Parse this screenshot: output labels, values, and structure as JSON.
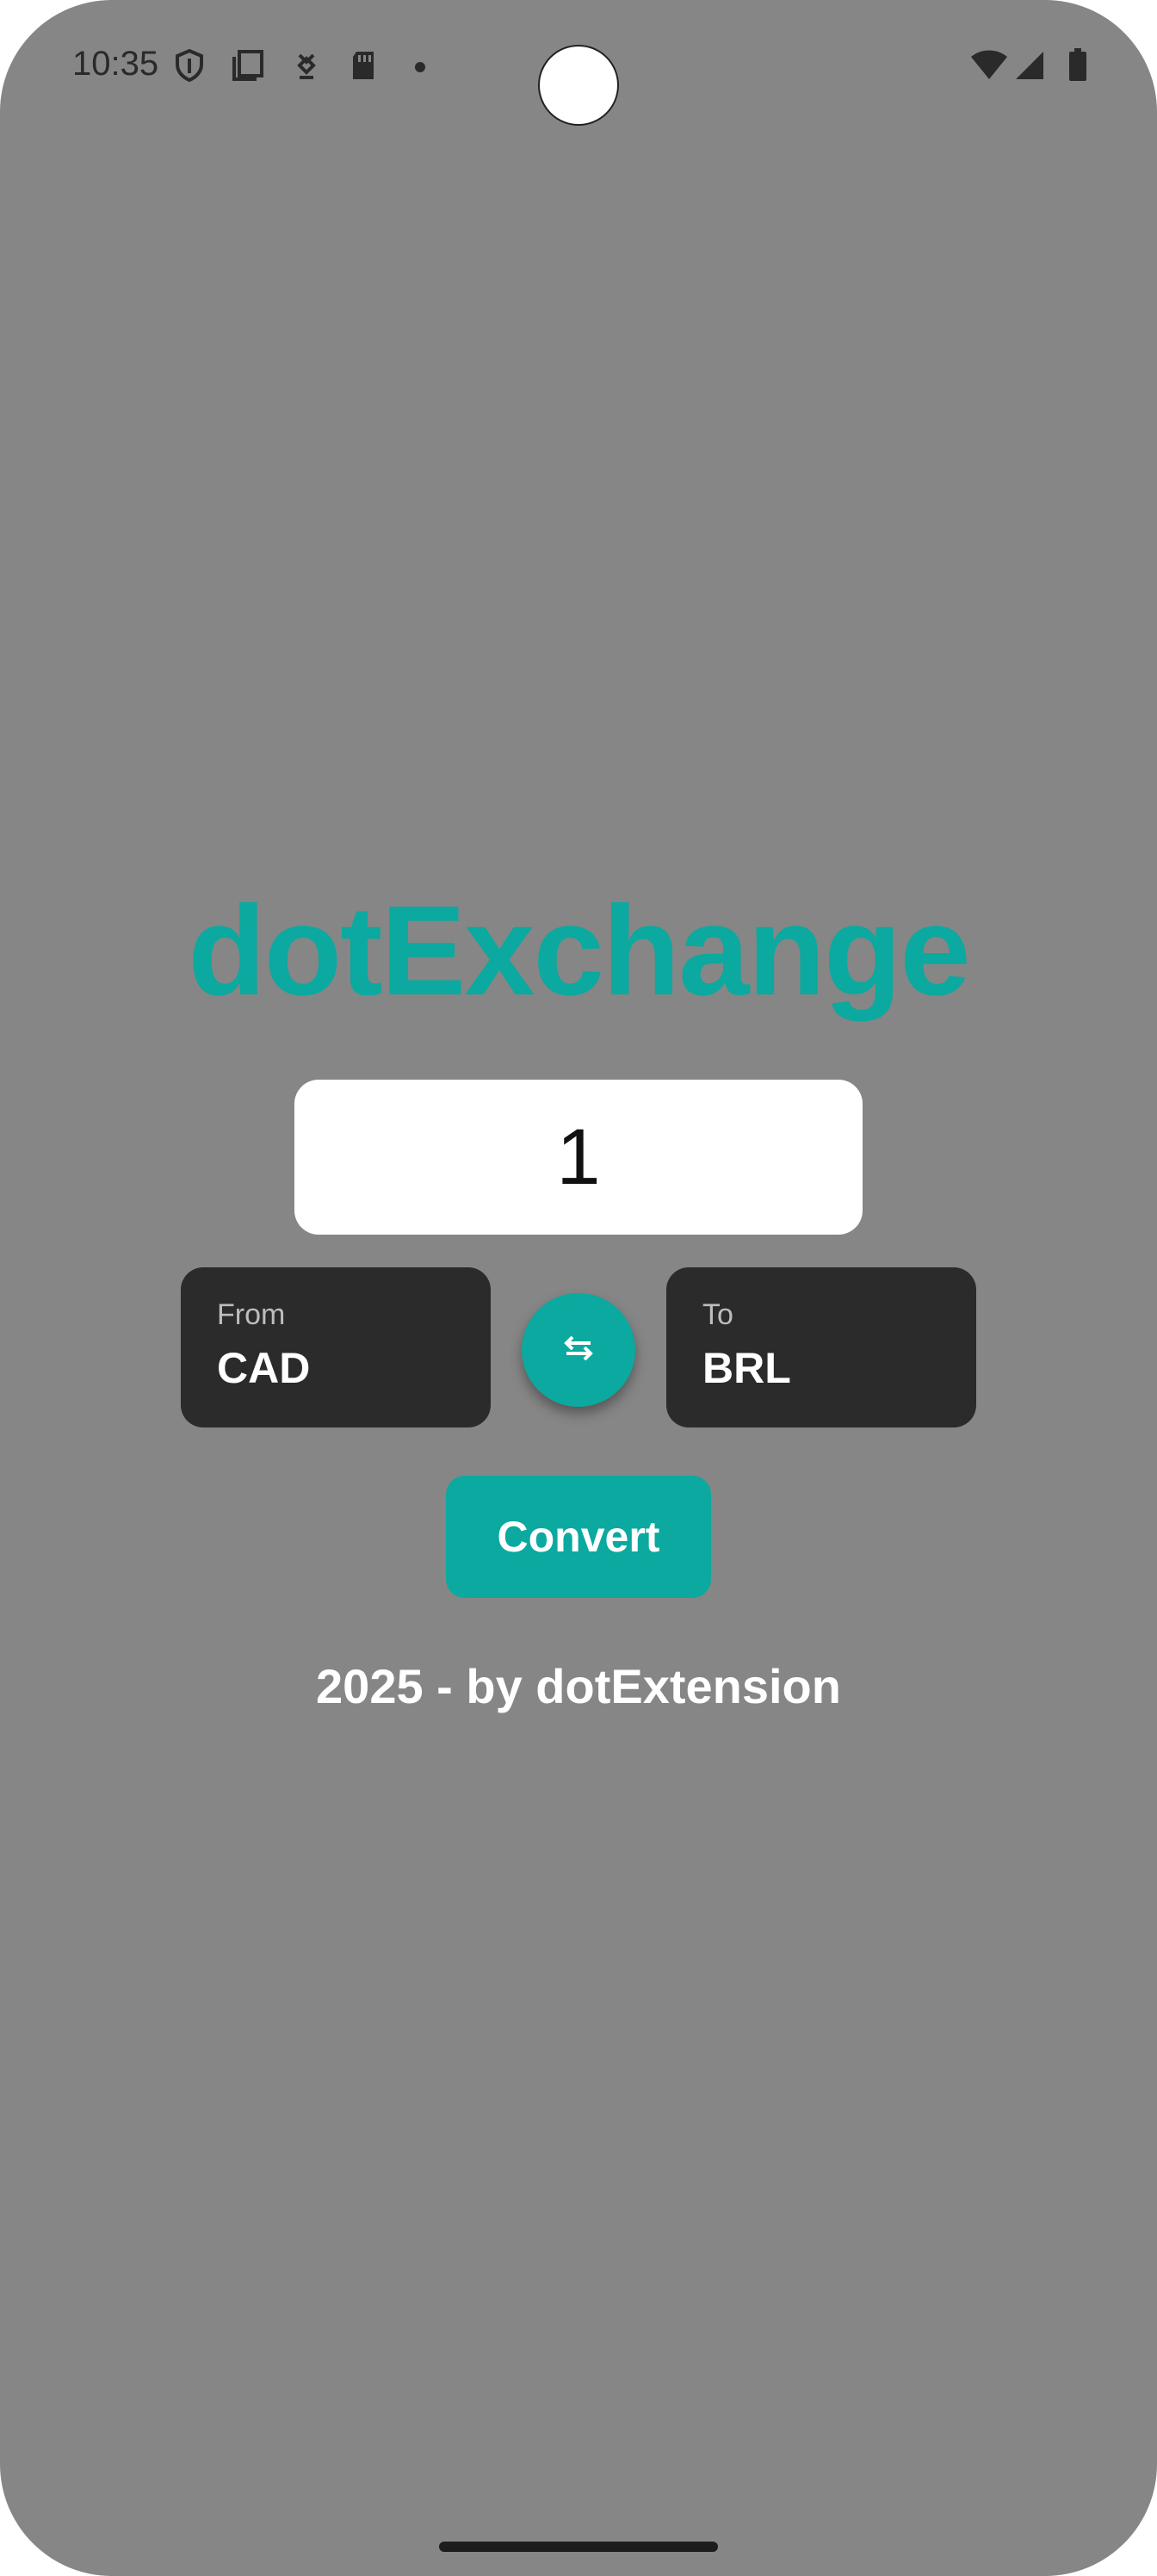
{
  "status_bar": {
    "time": "10:35",
    "left_icons": [
      "shield-icon",
      "screenshot-icon",
      "download-icon",
      "sd-card-icon",
      "dot-icon"
    ],
    "right_icons": [
      "wifi-icon",
      "signal-icon",
      "battery-icon"
    ]
  },
  "app": {
    "title": "dotExchange",
    "amount_value": "1",
    "from": {
      "label": "From",
      "currency": "CAD"
    },
    "to": {
      "label": "To",
      "currency": "BRL"
    },
    "swap_icon": "swap-arrows-icon",
    "convert_label": "Convert",
    "footer": "2025 - by dotExtension"
  },
  "colors": {
    "background": "#868686",
    "accent": "#0ba99f",
    "dark_box": "#2b2b2b",
    "input_bg": "#ffffff",
    "text_light": "#ffffff"
  }
}
